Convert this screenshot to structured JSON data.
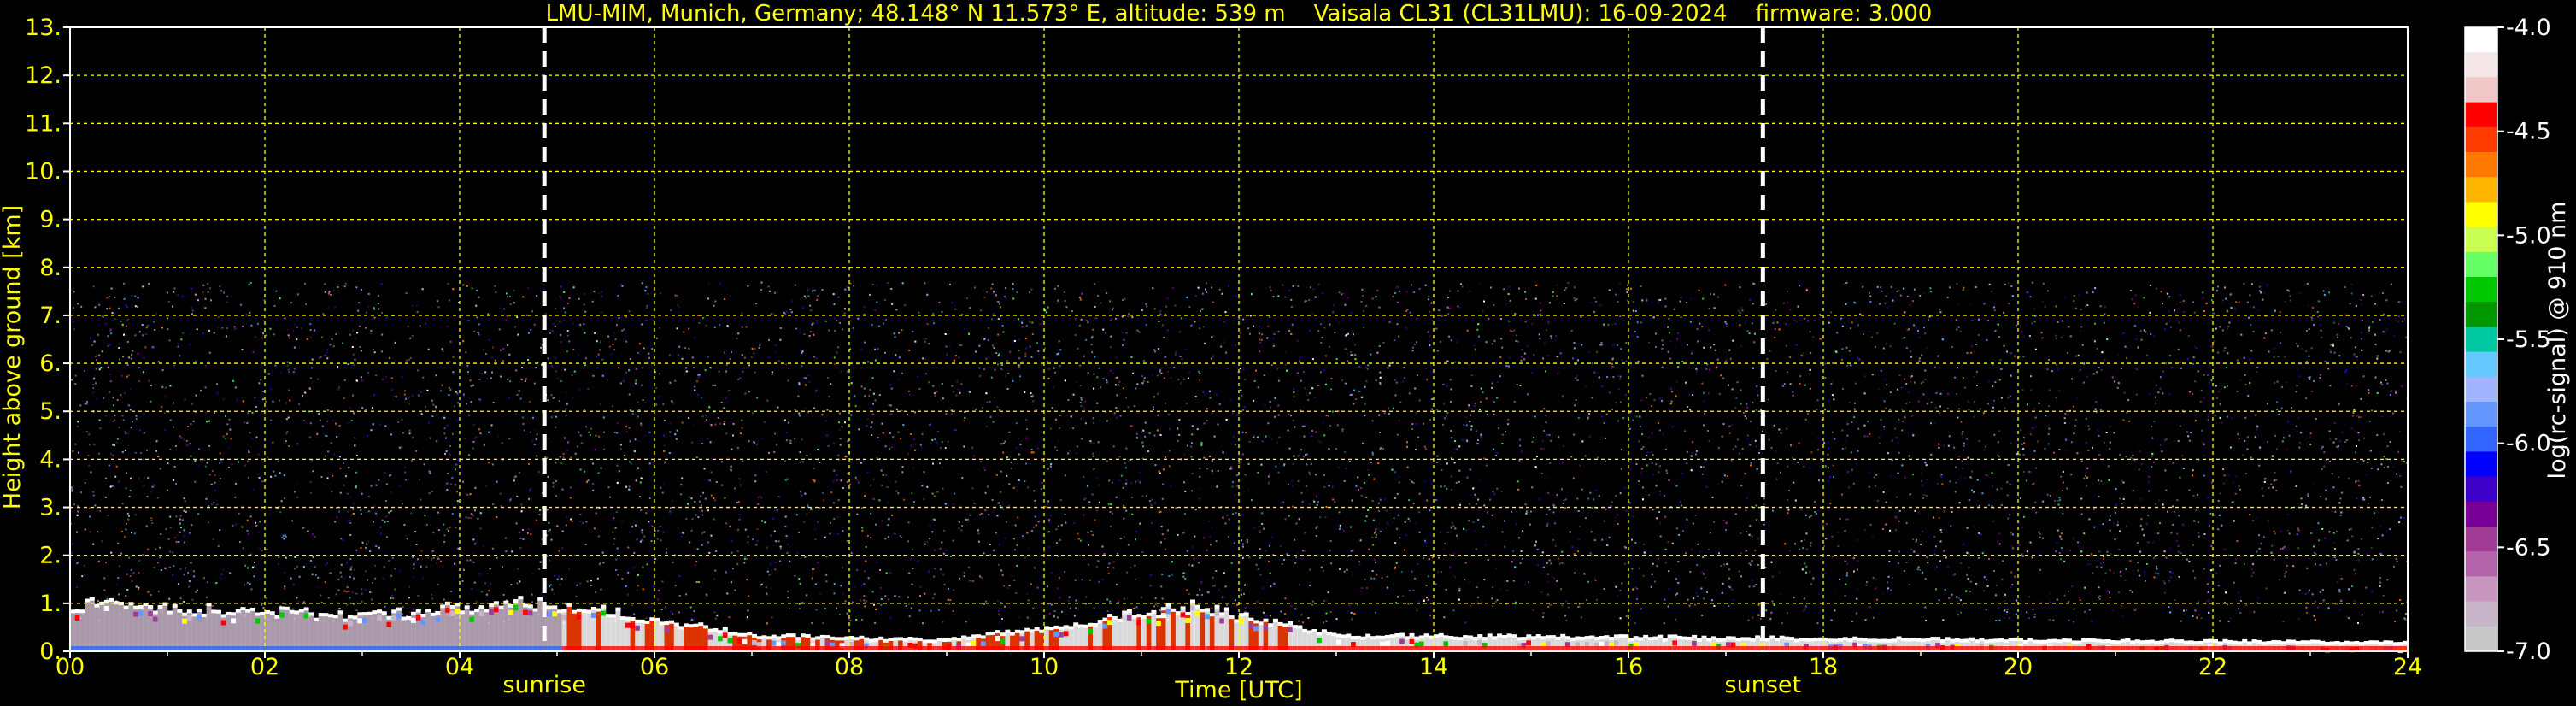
{
  "chart_data": {
    "type": "heatmap",
    "title": "LMU-MIM, Munich, Germany; 48.148° N 11.573° E, altitude: 539 m    Vaisala CL31 (CL31LMU): 16-09-2024    firmware: 3.000",
    "xlabel": "Time [UTC]",
    "ylabel": "Height above ground [km]",
    "xlim": [
      0,
      24
    ],
    "ylim": [
      0,
      13
    ],
    "x_ticks": [
      "00",
      "02",
      "04",
      "06",
      "08",
      "10",
      "12",
      "14",
      "16",
      "18",
      "20",
      "22",
      "24"
    ],
    "y_ticks": [
      "0.",
      "1.",
      "2.",
      "3.",
      "4.",
      "5.",
      "6.",
      "7.",
      "8.",
      "9.",
      "10.",
      "11.",
      "12.",
      "13."
    ],
    "grid": true,
    "grid_color": "#ffff00",
    "events": [
      {
        "label": "sunrise",
        "time": 4.87
      },
      {
        "label": "sunset",
        "time": 17.38
      }
    ],
    "colorbar": {
      "label": "log(rc-signal) @ 910 nm",
      "range": [
        -7.0,
        -4.0
      ],
      "ticks": [
        "-4.0",
        "-4.5",
        "-5.0",
        "-5.5",
        "-6.0",
        "-6.5",
        "-7.0"
      ],
      "colors": [
        "#ffffff",
        "#f4e6e6",
        "#f0c8c8",
        "#ff0000",
        "#ff3c00",
        "#ff7800",
        "#ffb400",
        "#ffff00",
        "#c8ff50",
        "#64ff64",
        "#00c800",
        "#009600",
        "#00c8a0",
        "#64c8ff",
        "#a0b4ff",
        "#6496ff",
        "#3264ff",
        "#0000ff",
        "#3c00c8",
        "#780096",
        "#a03c96",
        "#b464aa",
        "#c896be",
        "#c8b4c8",
        "#c8c8c8"
      ]
    },
    "profile_features": {
      "noise_top_km": 7.7,
      "boundary_layer_height_km": [
        {
          "t": 0,
          "h": 0.95
        },
        {
          "t": 1.5,
          "h": 0.85
        },
        {
          "t": 3.0,
          "h": 0.7
        },
        {
          "t": 4.5,
          "h": 1.0
        },
        {
          "t": 5.5,
          "h": 0.8
        },
        {
          "t": 7.0,
          "h": 0.3
        },
        {
          "t": 9.0,
          "h": 0.2
        },
        {
          "t": 11.5,
          "h": 0.9
        },
        {
          "t": 13.0,
          "h": 0.3
        },
        {
          "t": 17.0,
          "h": 0.25
        },
        {
          "t": 24.0,
          "h": 0.15
        }
      ]
    }
  }
}
